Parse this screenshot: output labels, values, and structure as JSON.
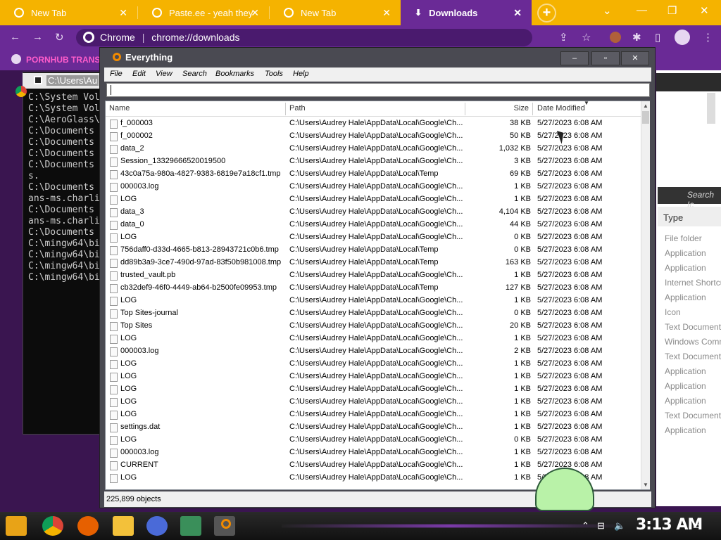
{
  "browser": {
    "tabs": [
      {
        "label": "New Tab"
      },
      {
        "label": "Paste.ee - yeah they"
      },
      {
        "label": "New Tab"
      },
      {
        "label": "Downloads"
      }
    ],
    "omnibox_label": "Chrome",
    "omnibox_url": "chrome://downloads",
    "bookmark_label": "PORNHUB TRANS"
  },
  "cmd": {
    "title": "C:\\Users\\Au",
    "lines": [
      "C:\\System Vol",
      "C:\\System Vol",
      "C:\\AeroGlass\\",
      "C:\\Documents",
      "C:\\Documents",
      "C:\\Documents",
      "C:\\Documents",
      "s.",
      "C:\\Documents",
      "ans-ms.charli",
      "C:\\Documents",
      "ans-ms.charli",
      "C:\\Documents",
      "C:\\mingw64\\bi",
      "C:\\mingw64\\bi",
      "C:\\mingw64\\bi",
      "C:\\mingw64\\bi"
    ]
  },
  "right_window": {
    "search_placeholder": "Search Ic",
    "type_header": "Type",
    "types": [
      "File folder",
      "Application",
      "Application",
      "Internet Shortcut",
      "Application",
      "Icon",
      "Text Document",
      "Windows Comma...",
      "Text Document",
      "Application",
      "Application",
      "Application",
      "Text Document",
      "Application"
    ]
  },
  "everything": {
    "title": "Everything",
    "menu": [
      "File",
      "Edit",
      "View",
      "Search",
      "Bookmarks",
      "Tools",
      "Help"
    ],
    "search_value": "",
    "columns": {
      "name": "Name",
      "path": "Path",
      "size": "Size",
      "date": "Date Modified"
    },
    "rows": [
      {
        "name": "f_000003",
        "path": "C:\\Users\\Audrey Hale\\AppData\\Local\\Google\\Ch...",
        "size": "38 KB",
        "date": "5/27/2023 6:08 AM"
      },
      {
        "name": "f_000002",
        "path": "C:\\Users\\Audrey Hale\\AppData\\Local\\Google\\Ch...",
        "size": "50 KB",
        "date": "5/27/2023 6:08 AM"
      },
      {
        "name": "data_2",
        "path": "C:\\Users\\Audrey Hale\\AppData\\Local\\Google\\Ch...",
        "size": "1,032 KB",
        "date": "5/27/2023 6:08 AM"
      },
      {
        "name": "Session_13329666520019500",
        "path": "C:\\Users\\Audrey Hale\\AppData\\Local\\Google\\Ch...",
        "size": "3 KB",
        "date": "5/27/2023 6:08 AM"
      },
      {
        "name": "43c0a75a-980a-4827-9383-6819e7a18cf1.tmp",
        "path": "C:\\Users\\Audrey Hale\\AppData\\Local\\Temp",
        "size": "69 KB",
        "date": "5/27/2023 6:08 AM"
      },
      {
        "name": "000003.log",
        "path": "C:\\Users\\Audrey Hale\\AppData\\Local\\Google\\Ch...",
        "size": "1 KB",
        "date": "5/27/2023 6:08 AM"
      },
      {
        "name": "LOG",
        "path": "C:\\Users\\Audrey Hale\\AppData\\Local\\Google\\Ch...",
        "size": "1 KB",
        "date": "5/27/2023 6:08 AM"
      },
      {
        "name": "data_3",
        "path": "C:\\Users\\Audrey Hale\\AppData\\Local\\Google\\Ch...",
        "size": "4,104 KB",
        "date": "5/27/2023 6:08 AM"
      },
      {
        "name": "data_0",
        "path": "C:\\Users\\Audrey Hale\\AppData\\Local\\Google\\Ch...",
        "size": "44 KB",
        "date": "5/27/2023 6:08 AM"
      },
      {
        "name": "LOG",
        "path": "C:\\Users\\Audrey Hale\\AppData\\Local\\Google\\Ch...",
        "size": "0 KB",
        "date": "5/27/2023 6:08 AM"
      },
      {
        "name": "756daff0-d33d-4665-b813-28943721c0b6.tmp",
        "path": "C:\\Users\\Audrey Hale\\AppData\\Local\\Temp",
        "size": "0 KB",
        "date": "5/27/2023 6:08 AM"
      },
      {
        "name": "dd89b3a9-3ce7-490d-97ad-83f50b981008.tmp",
        "path": "C:\\Users\\Audrey Hale\\AppData\\Local\\Temp",
        "size": "163 KB",
        "date": "5/27/2023 6:08 AM"
      },
      {
        "name": "trusted_vault.pb",
        "path": "C:\\Users\\Audrey Hale\\AppData\\Local\\Google\\Ch...",
        "size": "1 KB",
        "date": "5/27/2023 6:08 AM"
      },
      {
        "name": "cb32def9-46f0-4449-ab64-b2500fe09953.tmp",
        "path": "C:\\Users\\Audrey Hale\\AppData\\Local\\Temp",
        "size": "127 KB",
        "date": "5/27/2023 6:08 AM"
      },
      {
        "name": "LOG",
        "path": "C:\\Users\\Audrey Hale\\AppData\\Local\\Google\\Ch...",
        "size": "1 KB",
        "date": "5/27/2023 6:08 AM"
      },
      {
        "name": "Top Sites-journal",
        "path": "C:\\Users\\Audrey Hale\\AppData\\Local\\Google\\Ch...",
        "size": "0 KB",
        "date": "5/27/2023 6:08 AM"
      },
      {
        "name": "Top Sites",
        "path": "C:\\Users\\Audrey Hale\\AppData\\Local\\Google\\Ch...",
        "size": "20 KB",
        "date": "5/27/2023 6:08 AM"
      },
      {
        "name": "LOG",
        "path": "C:\\Users\\Audrey Hale\\AppData\\Local\\Google\\Ch...",
        "size": "1 KB",
        "date": "5/27/2023 6:08 AM"
      },
      {
        "name": "000003.log",
        "path": "C:\\Users\\Audrey Hale\\AppData\\Local\\Google\\Ch...",
        "size": "2 KB",
        "date": "5/27/2023 6:08 AM"
      },
      {
        "name": "LOG",
        "path": "C:\\Users\\Audrey Hale\\AppData\\Local\\Google\\Ch...",
        "size": "1 KB",
        "date": "5/27/2023 6:08 AM"
      },
      {
        "name": "LOG",
        "path": "C:\\Users\\Audrey Hale\\AppData\\Local\\Google\\Ch...",
        "size": "1 KB",
        "date": "5/27/2023 6:08 AM"
      },
      {
        "name": "LOG",
        "path": "C:\\Users\\Audrey Hale\\AppData\\Local\\Google\\Ch...",
        "size": "1 KB",
        "date": "5/27/2023 6:08 AM"
      },
      {
        "name": "LOG",
        "path": "C:\\Users\\Audrey Hale\\AppData\\Local\\Google\\Ch...",
        "size": "1 KB",
        "date": "5/27/2023 6:08 AM"
      },
      {
        "name": "LOG",
        "path": "C:\\Users\\Audrey Hale\\AppData\\Local\\Google\\Ch...",
        "size": "1 KB",
        "date": "5/27/2023 6:08 AM"
      },
      {
        "name": "settings.dat",
        "path": "C:\\Users\\Audrey Hale\\AppData\\Local\\Google\\Ch...",
        "size": "1 KB",
        "date": "5/27/2023 6:08 AM"
      },
      {
        "name": "LOG",
        "path": "C:\\Users\\Audrey Hale\\AppData\\Local\\Google\\Ch...",
        "size": "0 KB",
        "date": "5/27/2023 6:08 AM"
      },
      {
        "name": "000003.log",
        "path": "C:\\Users\\Audrey Hale\\AppData\\Local\\Google\\Ch...",
        "size": "1 KB",
        "date": "5/27/2023 6:08 AM"
      },
      {
        "name": "CURRENT",
        "path": "C:\\Users\\Audrey Hale\\AppData\\Local\\Google\\Ch...",
        "size": "1 KB",
        "date": "5/27/2023 6:08 AM"
      },
      {
        "name": "LOG",
        "path": "C:\\Users\\Audrey Hale\\AppData\\Local\\Google\\Ch...",
        "size": "1 KB",
        "date": "5/27/2023 6:08 AM"
      }
    ],
    "status": "225,899 objects"
  },
  "taskbar": {
    "clock": "3:13 AM",
    "apps": [
      "start-icon",
      "chrome-icon",
      "firefox-icon",
      "file-explorer-icon",
      "globe-app-icon",
      "terminal-icon",
      "everything-icon"
    ]
  }
}
